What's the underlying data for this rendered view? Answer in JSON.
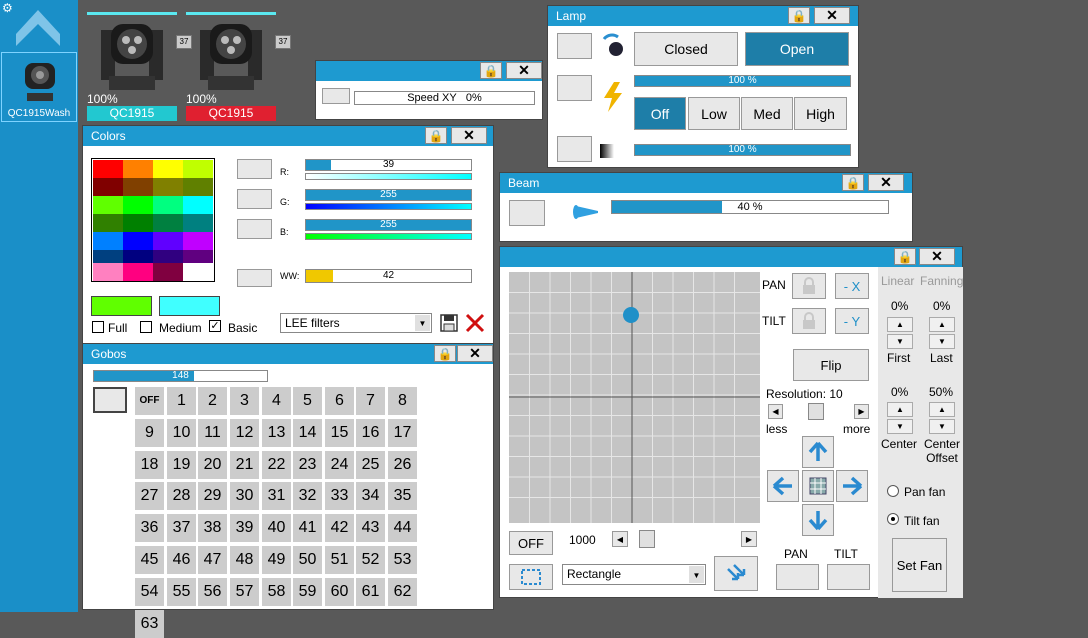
{
  "sidebar": {
    "fixture_label": "QC1915Wash"
  },
  "fixtures": [
    {
      "pct": "100%",
      "name": "QC1915",
      "badge": "37",
      "color": "#22c8d0"
    },
    {
      "pct": "100%",
      "name": "QC1915",
      "badge": "37",
      "color": "#e02030"
    }
  ],
  "speed": {
    "label": "Speed XY",
    "value": "0%"
  },
  "lamp": {
    "title": "Lamp",
    "closed": "Closed",
    "open": "Open",
    "bar1": "100 %",
    "bar1_value": 1.0,
    "off": "Off",
    "low": "Low",
    "med": "Med",
    "high": "High",
    "bar2": "100 %",
    "bar2_value": 1.0
  },
  "colors": {
    "title": "Colors",
    "r_label": "R:",
    "g_label": "G:",
    "b_label": "B:",
    "ww_label": "WW:",
    "r": "39",
    "g": "255",
    "b": "255",
    "ww": "42",
    "r_value": 39,
    "g_value": 255,
    "b_value": 255,
    "ww_value": 42,
    "full": "Full",
    "medium": "Medium",
    "basic": "Basic",
    "filter": "LEE filters"
  },
  "beam": {
    "title": "Beam",
    "value": "40 %",
    "level": 0.4
  },
  "gobos": {
    "title": "Gobos",
    "value": "148",
    "level": 0.58,
    "off": "OFF",
    "numbers": [
      "1",
      "2",
      "3",
      "4",
      "5",
      "6",
      "7",
      "8",
      "9",
      "10",
      "11",
      "12",
      "13",
      "14",
      "15",
      "16",
      "17",
      "18",
      "19",
      "20",
      "21",
      "22",
      "23",
      "24",
      "25",
      "26",
      "27",
      "28",
      "29",
      "30",
      "31",
      "32",
      "33",
      "34",
      "35",
      "36",
      "37",
      "38",
      "39",
      "40",
      "41",
      "42",
      "43",
      "44",
      "45",
      "46",
      "47",
      "48",
      "49",
      "50",
      "51",
      "52",
      "53",
      "54",
      "55",
      "56",
      "57",
      "58",
      "59",
      "60",
      "61",
      "62",
      "63"
    ]
  },
  "position": {
    "pan": "PAN",
    "tilt": "TILT",
    "neg_x": "- X",
    "neg_y": "- Y",
    "flip": "Flip",
    "resolution": "Resolution: 10",
    "less": "less",
    "more": "more",
    "off": "OFF",
    "speed_value": "1000",
    "shape": "Rectangle",
    "pan_btn": "PAN",
    "tilt_btn": "TILT",
    "linear": "Linear",
    "fanning": "Fanning",
    "first_pct": "0%",
    "last_pct": "0%",
    "first": "First",
    "last": "Last",
    "center_pct": "0%",
    "offset_pct": "50%",
    "center": "Center",
    "center_offset": "Center Offset",
    "pan_fan": "Pan fan",
    "tilt_fan": "Tilt fan",
    "set_fan": "Set Fan"
  }
}
